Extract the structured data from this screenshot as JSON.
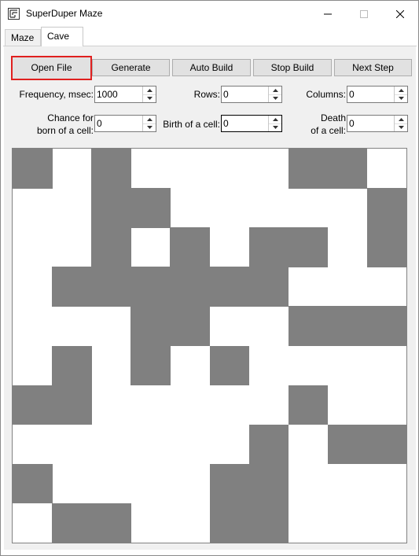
{
  "window": {
    "title": "SuperDuper Maze"
  },
  "tabs": [
    {
      "label": "Maze"
    },
    {
      "label": "Cave"
    }
  ],
  "buttons": {
    "open_file": "Open File",
    "generate": "Generate",
    "auto_build": "Auto Build",
    "stop_build": "Stop Build",
    "next_step": "Next Step"
  },
  "fields": {
    "frequency": {
      "label": "Frequency, msec:",
      "value": "1000"
    },
    "rows": {
      "label": "Rows:",
      "value": "0"
    },
    "columns": {
      "label": "Columns:",
      "value": "0"
    },
    "chance_born": {
      "label_line1": "Chance for",
      "label_line2": "born of a cell:",
      "value": "0"
    },
    "birth": {
      "label": "Birth of a cell:",
      "value": "0"
    },
    "death": {
      "label_line1": "Death",
      "label_line2": "of a cell:",
      "value": "0"
    }
  },
  "cave": {
    "grid_size": 10,
    "colors": {
      "wall": "#808080",
      "empty": "#ffffff",
      "highlight": "#e0201f"
    },
    "grid": [
      [
        1,
        0,
        1,
        0,
        0,
        0,
        0,
        1,
        1,
        0
      ],
      [
        0,
        0,
        1,
        1,
        0,
        0,
        0,
        0,
        0,
        1
      ],
      [
        0,
        0,
        1,
        0,
        1,
        0,
        1,
        1,
        0,
        1
      ],
      [
        0,
        1,
        1,
        1,
        1,
        1,
        1,
        0,
        0,
        0
      ],
      [
        0,
        0,
        0,
        1,
        1,
        0,
        0,
        1,
        1,
        1
      ],
      [
        0,
        1,
        0,
        1,
        0,
        1,
        0,
        0,
        0,
        0
      ],
      [
        1,
        1,
        0,
        0,
        0,
        0,
        0,
        1,
        0,
        0
      ],
      [
        0,
        0,
        0,
        0,
        0,
        0,
        1,
        0,
        1,
        1
      ],
      [
        1,
        0,
        0,
        0,
        0,
        1,
        1,
        0,
        0,
        0
      ],
      [
        0,
        1,
        1,
        0,
        0,
        1,
        1,
        0,
        0,
        0
      ]
    ]
  }
}
